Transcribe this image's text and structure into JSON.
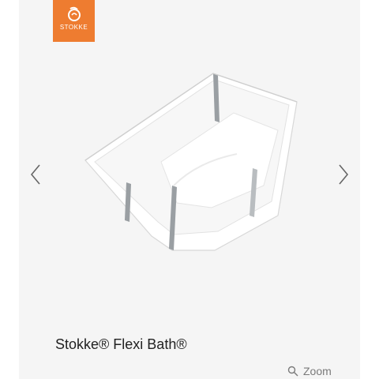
{
  "brand": {
    "name": "STOKKE",
    "accent_color": "#ee7c30"
  },
  "carousel": {
    "prev_icon": "chevron-left-icon",
    "next_icon": "chevron-right-icon"
  },
  "product": {
    "title": "Stokke® Flexi Bath®"
  },
  "zoom": {
    "icon": "search-icon",
    "label": "Zoom"
  }
}
